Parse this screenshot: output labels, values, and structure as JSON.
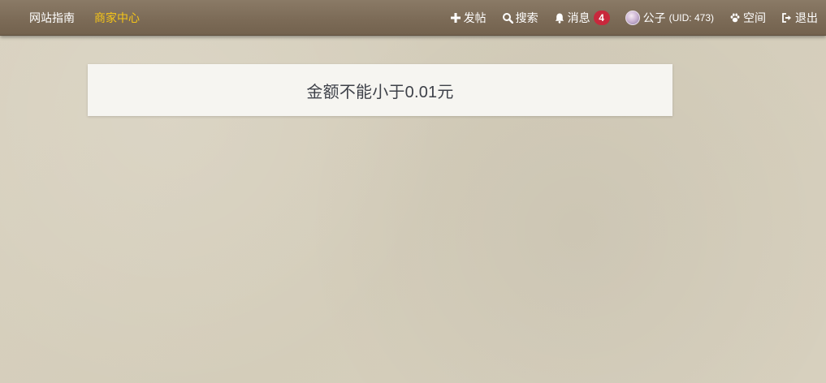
{
  "topbar": {
    "left_links": [
      {
        "label": "网站指南",
        "active": false
      },
      {
        "label": "商家中心",
        "active": true
      }
    ],
    "post_label": "发帖",
    "search_label": "搜索",
    "messages_label": "消息",
    "messages_count": "4",
    "user_name": "公子",
    "user_uid": "(UID: 473)",
    "space_label": "空间",
    "logout_label": "退出"
  },
  "message": {
    "text": "金额不能小于0.01元"
  },
  "colors": {
    "topbar": "#7b6a56",
    "active_link": "#f5c518",
    "badge": "#c8283c",
    "page_bg": "#d6cfbd",
    "message_bg": "#f6f5f1"
  },
  "icons": {
    "post": "plus-icon",
    "search": "search-icon",
    "messages": "bell-icon",
    "space": "paw-icon",
    "logout": "logout-icon"
  }
}
